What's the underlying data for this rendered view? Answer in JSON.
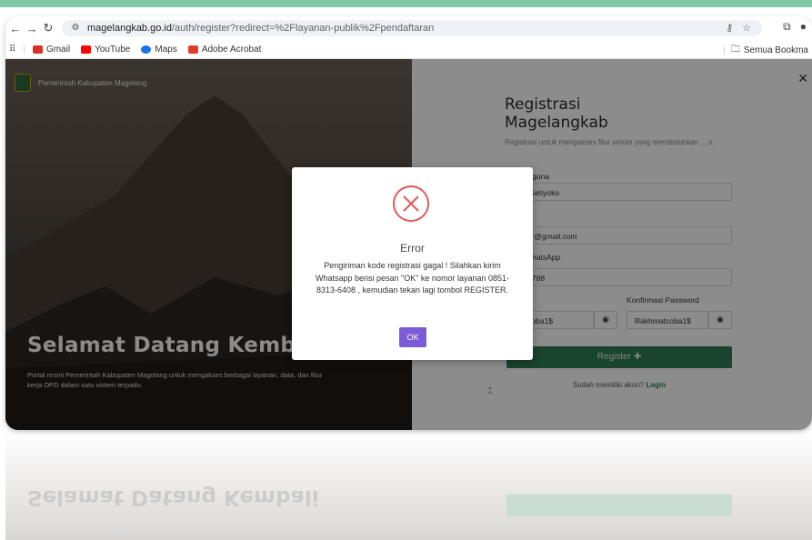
{
  "browser": {
    "url_host": "magelangkab.go.id",
    "url_path": "/auth/register?redirect=%2Flayanan-publik%2Fpendaftaran",
    "bookmarks": [
      {
        "label": "Gmail",
        "icon": "gmail-icon",
        "color": "#d93025"
      },
      {
        "label": "YouTube",
        "icon": "youtube-icon",
        "color": "#ff0000"
      },
      {
        "label": "Maps",
        "icon": "maps-icon",
        "color": "#1a73e8"
      },
      {
        "label": "Adobe Acrobat",
        "icon": "acrobat-icon",
        "color": "#e33b2a"
      }
    ],
    "all_bookmarks": "Semua Bookma"
  },
  "hero": {
    "brand": "Pemerintah Kabupaten Magelang",
    "welcome": "Selamat Datang Kembali",
    "tagline": "Portal resmi Pemerintah Kabupaten Magelang untuk mengakses berbagai layanan, data, dan fitur kerja OPD dalam satu sistem terpadu."
  },
  "form": {
    "title_line1": "Registrasi",
    "title_line2": "Magelangkab",
    "subtitle": "Registrasi untuk mengakses fitur umum yang membutuhkan ... s.",
    "username_label": "engguna",
    "username_value": "mat Setiyoko",
    "email_value": "sugar@gmail.com",
    "whatsapp_label": "WhatsApp",
    "whatsapp_value": "6205788",
    "password_label": "rd",
    "password_value": "matcoba1$",
    "confirm_label": "Konfirmasi Password",
    "confirm_value": "Rakhmatcoba1$",
    "register_label": "Register",
    "login_prompt": "Sudah memiliki akun?",
    "login_link": "Login"
  },
  "modal": {
    "title": "Error",
    "message": "Pengiriman kode registrasi gagal ! Silahkan kirim Whatsapp berisi pesan \"OK\" ke nomor layanan 0851-8313-6408 , kemudian tekan lagi tombol REGISTER.",
    "ok_label": "OK",
    "accent": "#e05a5a",
    "button_color": "#7b5cd6"
  },
  "colors": {
    "register_green": "#2e7d52"
  }
}
